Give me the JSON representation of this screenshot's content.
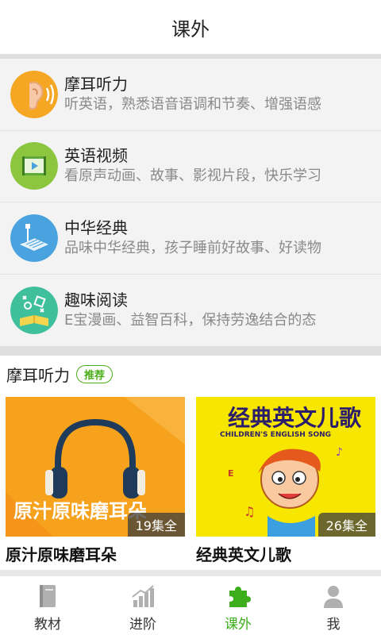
{
  "header": {
    "title": "课外"
  },
  "categories": [
    {
      "title": "摩耳听力",
      "desc": "听英语，熟悉语音语调和节奏、增强语感",
      "icon": "ear-icon",
      "color": "#f5a623"
    },
    {
      "title": "英语视频",
      "desc": "看原声动画、故事、影视片段，快乐学习",
      "icon": "video-icon",
      "color": "#8cc63f"
    },
    {
      "title": "中华经典",
      "desc": "品味中华经典，孩子睡前好故事、好读物",
      "icon": "classic-book-icon",
      "color": "#4aa3df"
    },
    {
      "title": "趣味阅读",
      "desc": "E宝漫画、益智百科，保持劳逸结合的态",
      "icon": "reading-icon",
      "color": "#3fbf9b"
    }
  ],
  "recommend": {
    "section_title": "摩耳听力",
    "badge": "推荐",
    "items": [
      {
        "title": "原汁原味磨耳朵",
        "count": "19集全",
        "cover_text": "原汁原味磨耳朵",
        "cover_bg": "#f7a21c"
      },
      {
        "title": "经典英文儿歌",
        "count": "26集全",
        "cover_text": "经典英文儿歌",
        "cover_sub": "CHILDREN'S ENGLISH SONG",
        "cover_bg": "#f7e600"
      }
    ]
  },
  "tabs": [
    {
      "label": "教材",
      "icon": "textbook-icon",
      "active": false
    },
    {
      "label": "进阶",
      "icon": "progress-chart-icon",
      "active": false
    },
    {
      "label": "课外",
      "icon": "puzzle-icon",
      "active": true
    },
    {
      "label": "我",
      "icon": "user-icon",
      "active": false
    }
  ],
  "colors": {
    "accent": "#3cae1c",
    "inactive_icon": "#b0b0b0"
  }
}
